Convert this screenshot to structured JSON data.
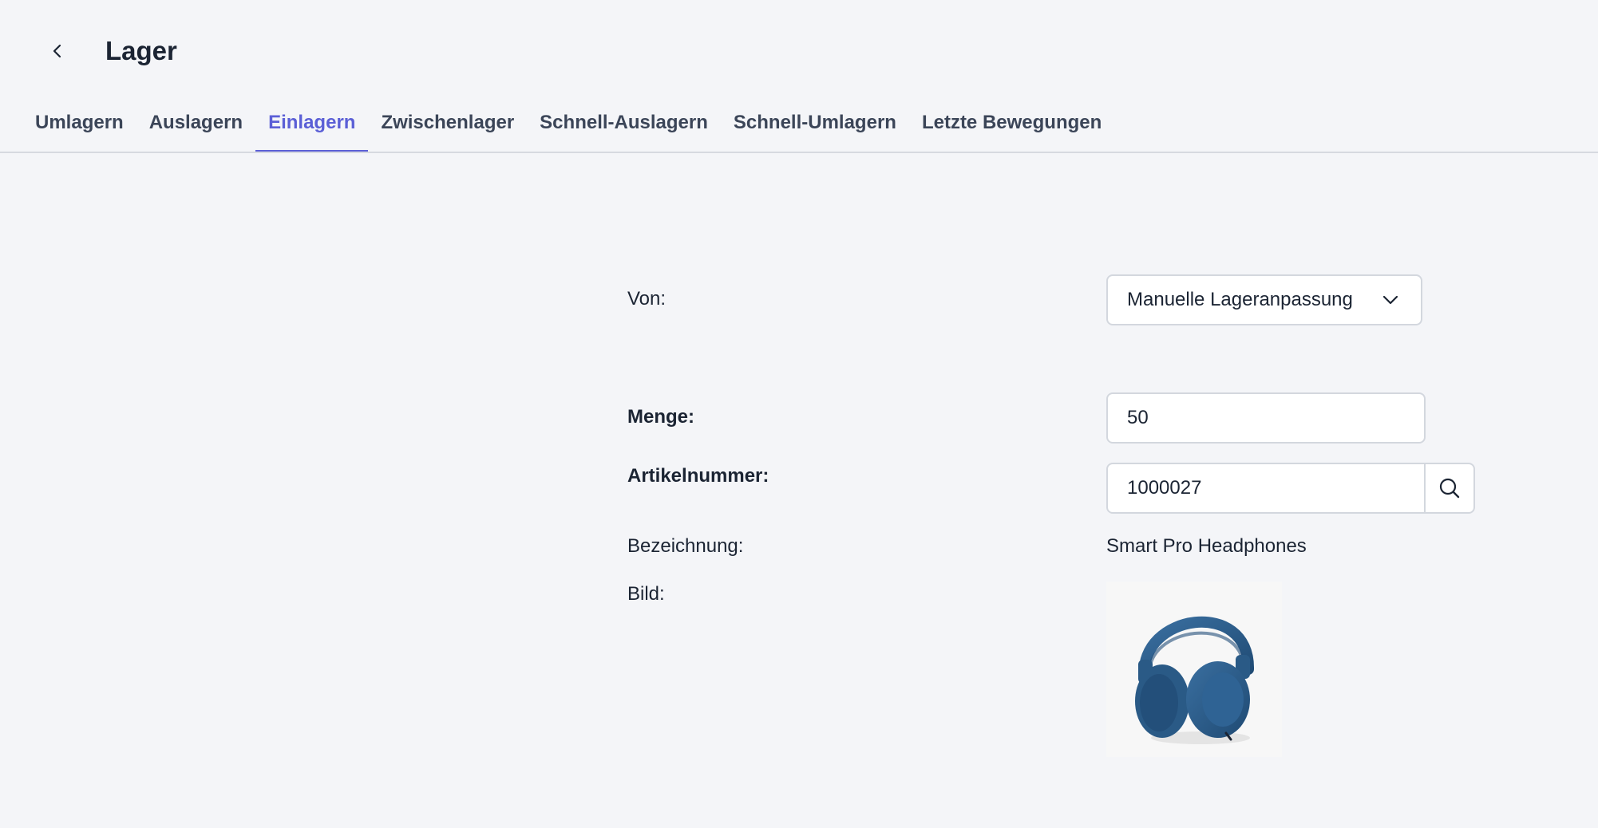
{
  "header": {
    "title": "Lager",
    "back_icon": "chevron-left-icon"
  },
  "tabs": [
    {
      "label": "Umlagern",
      "active": false
    },
    {
      "label": "Auslagern",
      "active": false
    },
    {
      "label": "Einlagern",
      "active": true
    },
    {
      "label": "Zwischenlager",
      "active": false
    },
    {
      "label": "Schnell-Auslagern",
      "active": false
    },
    {
      "label": "Schnell-Umlagern",
      "active": false
    },
    {
      "label": "Letzte Bewegungen",
      "active": false
    }
  ],
  "form": {
    "from_label": "Von:",
    "from_value": "Manuelle Lageranpassung",
    "quantity_label": "Menge:",
    "quantity_value": "50",
    "article_label": "Artikelnummer:",
    "article_value": "1000027",
    "description_label": "Bezeichnung:",
    "description_value": "Smart Pro Headphones",
    "image_label": "Bild:"
  },
  "colors": {
    "accent": "#5b5fd6",
    "background": "#f4f5f8",
    "text": "#1b2433",
    "product": "#2a5a86"
  }
}
